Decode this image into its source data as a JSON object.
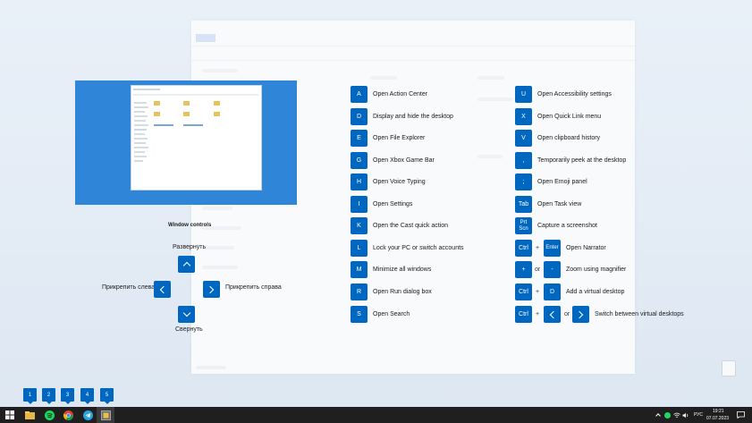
{
  "window_controls": {
    "title": "Window controls",
    "up_label": "Развернуть",
    "left_label": "Прикрепить слева",
    "right_label": "Прикрепить справа",
    "down_label": "Свернуть"
  },
  "shortcuts_left": [
    {
      "key": "A",
      "label": "Open Action Center"
    },
    {
      "key": "D",
      "label": "Display and hide the desktop"
    },
    {
      "key": "E",
      "label": "Open File Explorer"
    },
    {
      "key": "G",
      "label": "Open Xbox Game Bar"
    },
    {
      "key": "H",
      "label": "Open Voice Typing"
    },
    {
      "key": "I",
      "label": "Open Settings"
    },
    {
      "key": "K",
      "label": "Open the Cast quick action"
    },
    {
      "key": "L",
      "label": "Lock your PC or switch accounts"
    },
    {
      "key": "M",
      "label": "Minimize all windows"
    },
    {
      "key": "R",
      "label": "Open Run dialog box"
    },
    {
      "key": "S",
      "label": "Open Search"
    }
  ],
  "shortcuts_right": {
    "u": {
      "key": "U",
      "label": "Open Accessibility settings"
    },
    "x": {
      "key": "X",
      "label": "Open Quick Link menu"
    },
    "v": {
      "key": "V",
      "label": "Open clipboard history"
    },
    "comma": {
      "key": ",",
      "label": "Temporarily peek at the desktop"
    },
    "semicolon": {
      "key": ";",
      "label": "Open Emoji panel"
    },
    "tab": {
      "key": "Tab",
      "label": "Open Task view"
    },
    "prtscn": {
      "key_line1": "Prt",
      "key_line2": "Scn",
      "label": "Capture a screenshot"
    },
    "narrator": {
      "key1": "Ctrl",
      "plus": "+",
      "key2": "Enter",
      "label": "Open Narrator"
    },
    "magnifier": {
      "key1": "+",
      "or": "or",
      "key2": "-",
      "label": "Zoom using magnifier"
    },
    "vdesktop": {
      "key1": "Ctrl",
      "plus": "+",
      "key2": "D",
      "label": "Add a virtual desktop"
    },
    "switchdesk": {
      "key1": "Ctrl",
      "plus": "+",
      "key2": "<",
      "or": "or",
      "key3": ">",
      "label": "Switch between virtual desktops"
    }
  },
  "badges": [
    "1",
    "2",
    "3",
    "4",
    "5"
  ],
  "taskbar": {
    "lang": "РУС",
    "time": "19:21",
    "date": "07.07.2023",
    "icons": [
      "windows-icon",
      "file-explorer-icon",
      "spotify-icon",
      "chrome-icon",
      "telegram-icon",
      "app-icon"
    ]
  },
  "colors": {
    "accent": "#0067c0",
    "preview_bg": "#2f86d8",
    "taskbar": "#1f1f1f"
  }
}
